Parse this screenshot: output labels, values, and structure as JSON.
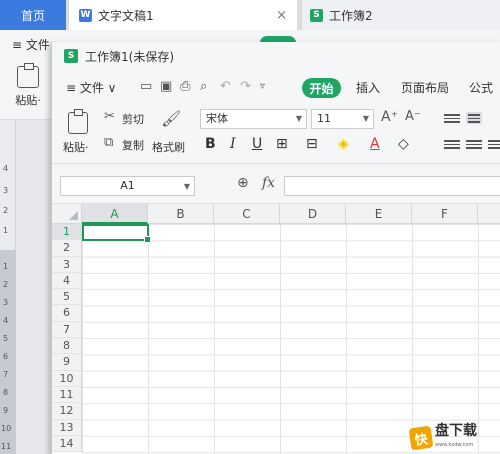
{
  "tabs": {
    "home": "首页",
    "doc": "文字文稿1",
    "doc_icon": "W",
    "book2": "工作簿2",
    "book2_icon": "S",
    "close": "×"
  },
  "back_ribbon": {
    "menu": "≡ 文件",
    "paste": "粘贴·"
  },
  "ruler_numbers": [
    "4",
    "3",
    "2",
    "1",
    "1",
    "2",
    "3",
    "4",
    "5",
    "6",
    "7",
    "8",
    "9",
    "10",
    "11"
  ],
  "window": {
    "title": "工作簿1(未保存)",
    "title_icon": "S"
  },
  "menubar": {
    "file": "≡  文件  ∨",
    "start": "开始",
    "insert": "插入",
    "page_layout": "页面布局",
    "formula": "公式"
  },
  "toolbar": {
    "paste": "粘贴·",
    "cut": "剪切",
    "copy": "复制",
    "format_painter": "格式刷",
    "font": "宋体",
    "font_size": "11",
    "bold": "B",
    "italic": "I",
    "underline": "U",
    "grow_font": "A⁺",
    "shrink_font": "A⁻"
  },
  "formula_bar": {
    "name_box": "A1",
    "fx": "fx"
  },
  "grid": {
    "columns": [
      "A",
      "B",
      "C",
      "D",
      "E",
      "F"
    ],
    "rows": [
      "1",
      "2",
      "3",
      "4",
      "5",
      "6",
      "7",
      "8",
      "9",
      "10",
      "11",
      "12",
      "13",
      "14"
    ],
    "selected_cell": "A1"
  },
  "watermark": {
    "logo": "快",
    "text": "盘下载",
    "sub": "www.kxdw.com"
  },
  "colors": {
    "accent_green": "#20a565",
    "tab_blue": "#3b7be0"
  }
}
